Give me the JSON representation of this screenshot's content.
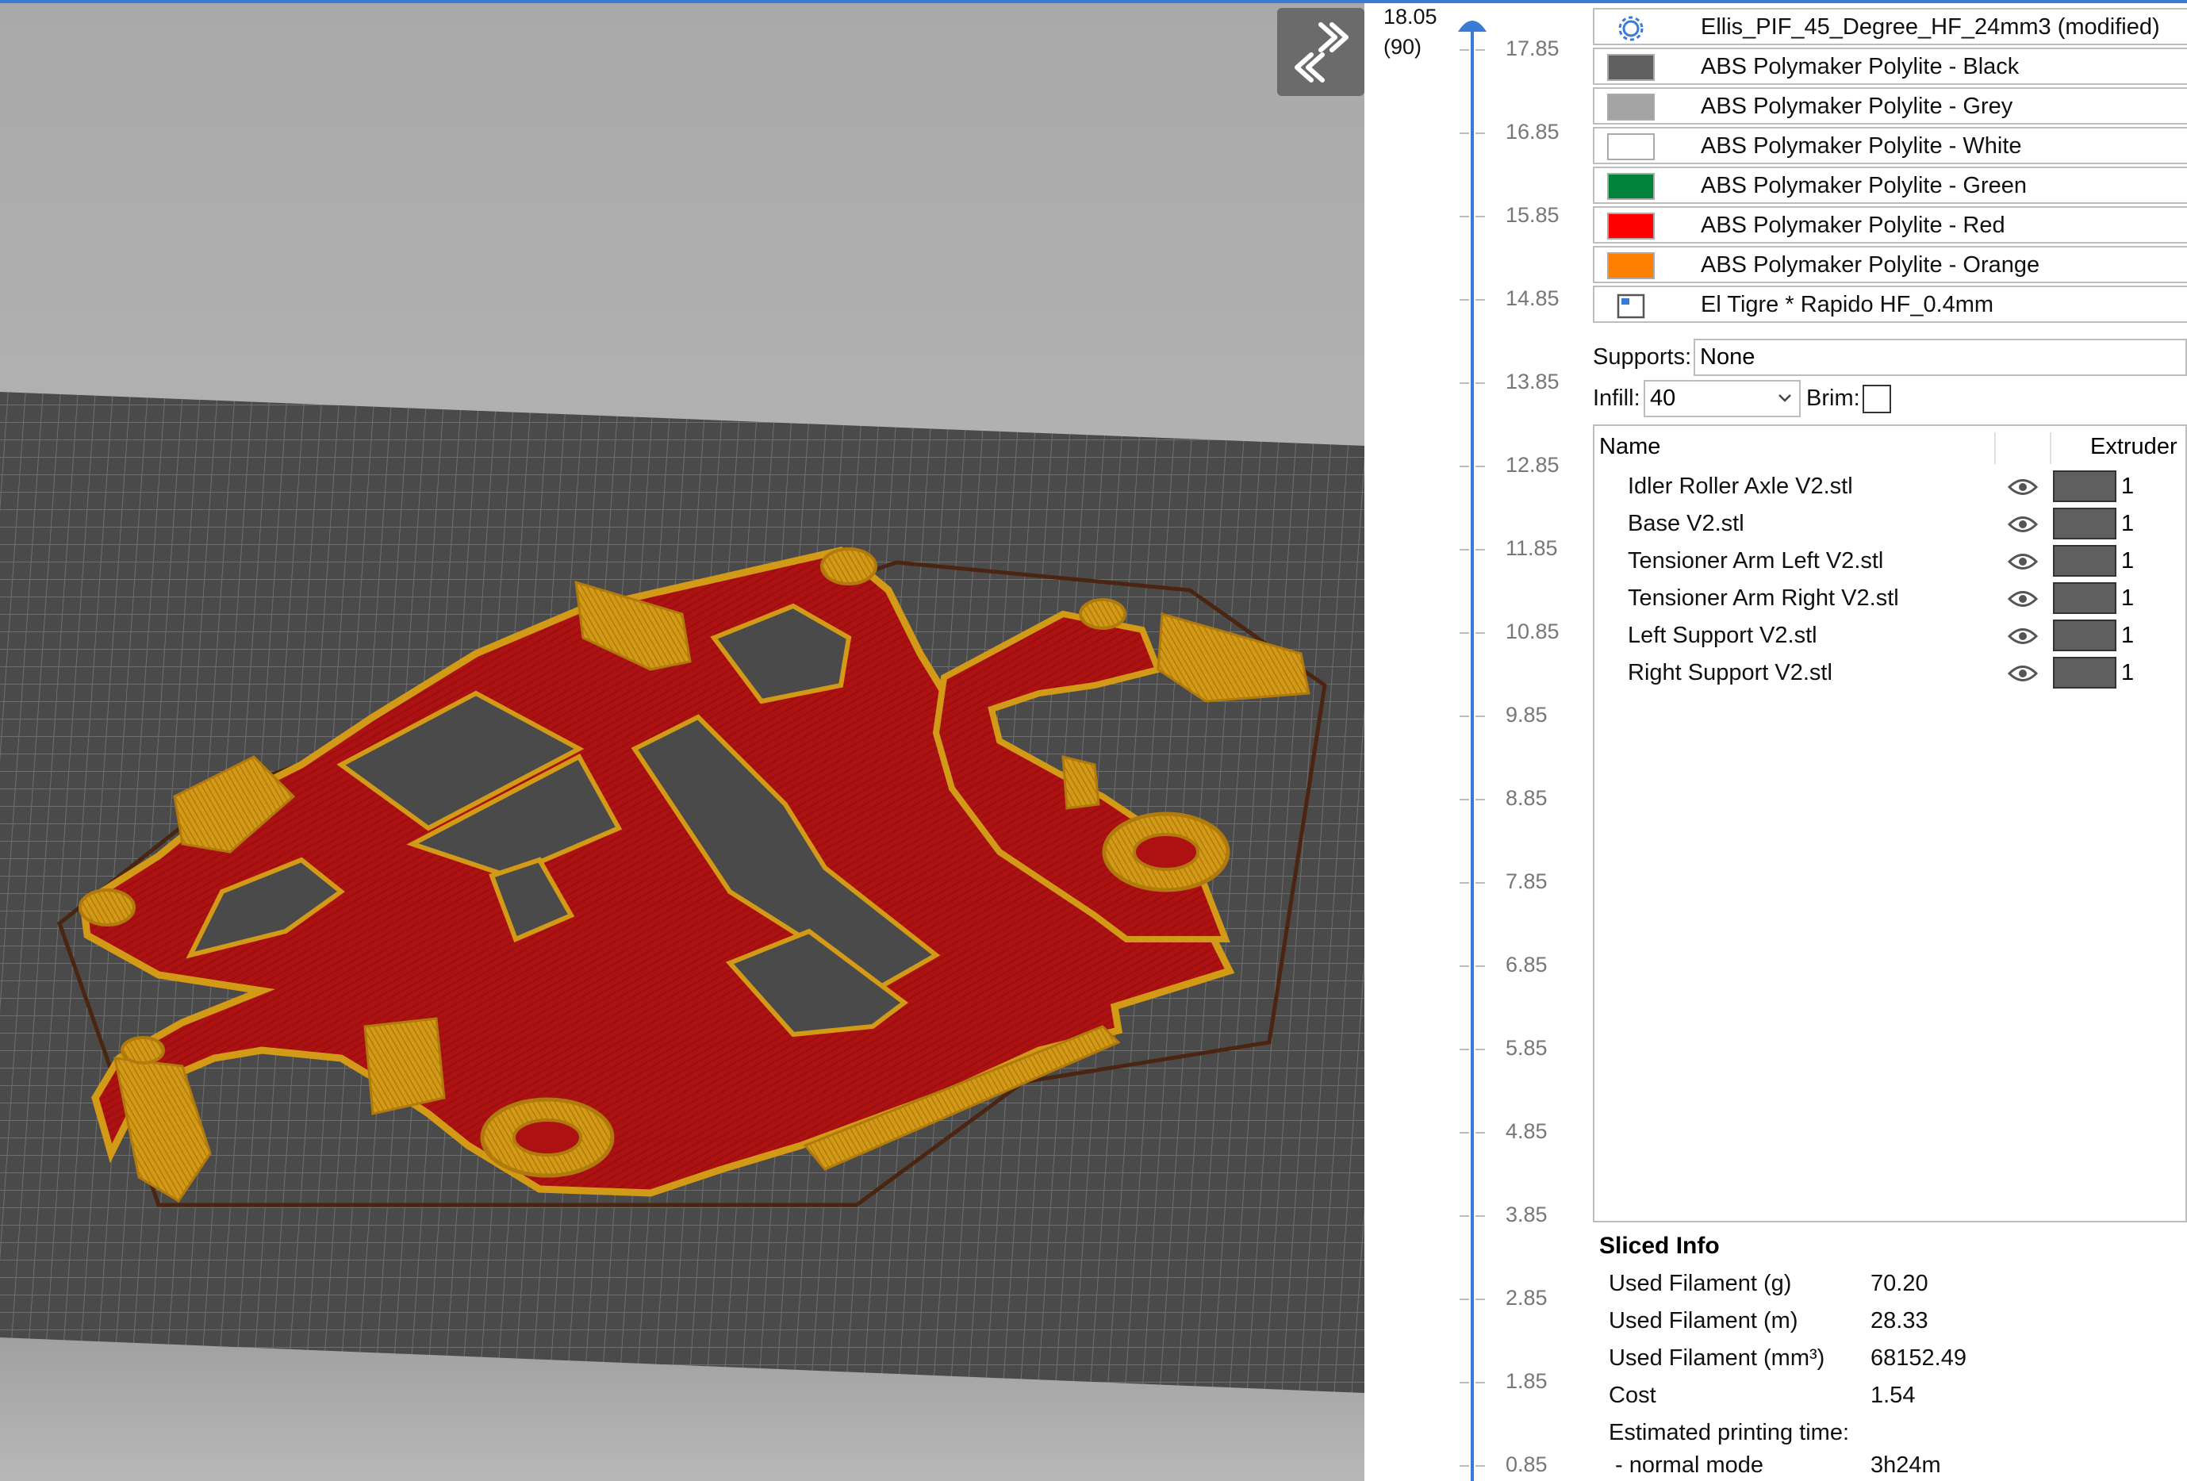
{
  "layer_slider": {
    "top_value": "18.05",
    "top_index": "(90)",
    "ticks": [
      "17.85",
      "16.85",
      "15.85",
      "14.85",
      "13.85",
      "12.85",
      "11.85",
      "10.85",
      "9.85",
      "8.85",
      "7.85",
      "6.85",
      "5.85",
      "4.85",
      "3.85",
      "2.85",
      "1.85",
      "0.85"
    ]
  },
  "presets": {
    "print_profile": "Ellis_PIF_45_Degree_HF_24mm3 (modified)",
    "filaments": [
      {
        "label": "ABS Polymaker Polylite - Black",
        "color": "#5f5f5f"
      },
      {
        "label": "ABS Polymaker Polylite - Grey",
        "color": "#a3a3a3"
      },
      {
        "label": "ABS Polymaker Polylite - White",
        "color": "#ffffff"
      },
      {
        "label": "ABS Polymaker Polylite - Green",
        "color": "#00843c"
      },
      {
        "label": "ABS Polymaker Polylite - Red",
        "color": "#ff0000"
      },
      {
        "label": "ABS Polymaker Polylite - Orange",
        "color": "#ff8000"
      }
    ],
    "printer": "El Tigre * Rapido HF_0.4mm"
  },
  "settings": {
    "supports_label": "Supports:",
    "supports_value": "None",
    "infill_label": "Infill:",
    "infill_value": "40",
    "brim_label": "Brim:"
  },
  "objects": {
    "header_name": "Name",
    "header_extruder": "Extruder",
    "rows": [
      {
        "name": "Idler Roller Axle V2.stl",
        "extruder": "1"
      },
      {
        "name": "Base V2.stl",
        "extruder": "1"
      },
      {
        "name": "Tensioner Arm Left V2.stl",
        "extruder": "1"
      },
      {
        "name": "Tensioner Arm Right V2.stl",
        "extruder": "1"
      },
      {
        "name": "Left Support V2.stl",
        "extruder": "1"
      },
      {
        "name": "Right Support V2.stl",
        "extruder": "1"
      }
    ]
  },
  "sliced_info": {
    "title": "Sliced Info",
    "rows": [
      {
        "label": "Used Filament (g)",
        "value": "70.20"
      },
      {
        "label": "Used Filament (m)",
        "value": "28.33"
      },
      {
        "label": "Used Filament (mm³)",
        "value": "68152.49"
      },
      {
        "label": "Cost",
        "value": "1.54"
      },
      {
        "label": "Estimated printing time:",
        "value": ""
      },
      {
        "label": " - normal mode",
        "value": "3h24m"
      }
    ]
  },
  "colors": {
    "accent": "#3a7bd5",
    "part_red": "#ad1111",
    "part_gold": "#d29a16",
    "bed": "#4a4a4a"
  }
}
